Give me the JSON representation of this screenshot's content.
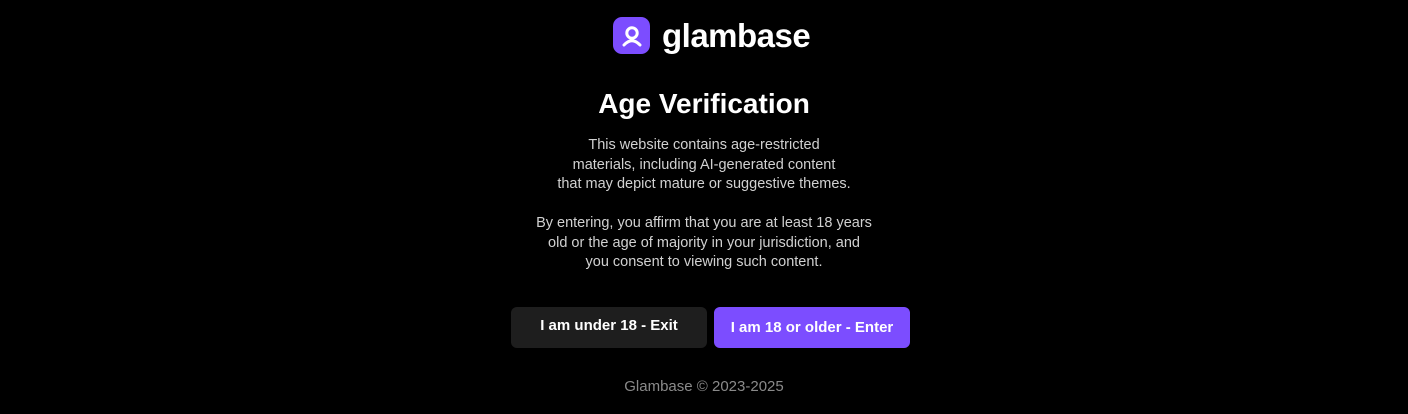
{
  "brand": {
    "name": "glambase",
    "accent_color": "#7c4dff",
    "logo_icon": "person-badge-icon"
  },
  "modal": {
    "title": "Age Verification",
    "paragraph1": [
      "This website contains age-restricted",
      "materials, including AI-generated content",
      "that may depict mature or suggestive themes."
    ],
    "paragraph2": [
      "By entering, you affirm that you are at least 18 years",
      "old or the age of majority in your jurisdiction, and",
      "you consent to viewing such content."
    ],
    "exit_label": "I am under 18 - Exit",
    "enter_label": "I am 18 or older - Enter"
  },
  "footer": {
    "copyright": "Glambase © 2023-2025"
  }
}
